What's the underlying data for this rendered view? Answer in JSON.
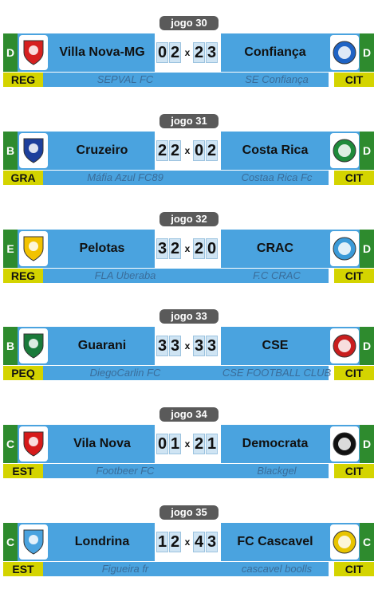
{
  "matches": [
    {
      "jogo": "jogo 30",
      "left_div": "D",
      "left_team": "Villa Nova-MG",
      "left_goals": [
        "0",
        "2"
      ],
      "right_goals": [
        "2",
        "3"
      ],
      "right_team": "Confiança",
      "right_div": "D",
      "left_cat": "REG",
      "left_coach": "SEPVAL FC",
      "right_coach": "SE Confiança",
      "right_cat": "CIT",
      "left_icon": "villa-nova-crest-icon",
      "right_icon": "confianca-crest-icon",
      "left_color": "#d62020",
      "right_color": "#1f63c4"
    },
    {
      "jogo": "jogo 31",
      "left_div": "B",
      "left_team": "Cruzeiro",
      "left_goals": [
        "2",
        "2"
      ],
      "right_goals": [
        "0",
        "2"
      ],
      "right_team": "Costa Rica",
      "right_div": "D",
      "left_cat": "GRA",
      "left_coach": "Máfia Azul FC89",
      "right_coach": "Costaa Rica Fc",
      "right_cat": "CIT",
      "left_icon": "cruzeiro-crest-icon",
      "right_icon": "costa-rica-crest-icon",
      "left_color": "#1d3f9c",
      "right_color": "#1f8a3a"
    },
    {
      "jogo": "jogo 32",
      "left_div": "E",
      "left_team": "Pelotas",
      "left_goals": [
        "3",
        "2"
      ],
      "right_goals": [
        "2",
        "0"
      ],
      "right_team": "CRAC",
      "right_div": "D",
      "left_cat": "REG",
      "left_coach": "FLA Uberaba",
      "right_coach": "F.C CRAC",
      "right_cat": "CIT",
      "left_icon": "pelotas-crest-icon",
      "right_icon": "crac-crest-icon",
      "left_color": "#f2c200",
      "right_color": "#3b9ad8"
    },
    {
      "jogo": "jogo 33",
      "left_div": "B",
      "left_team": "Guarani",
      "left_goals": [
        "3",
        "3"
      ],
      "right_goals": [
        "3",
        "3"
      ],
      "right_team": "CSE",
      "right_div": "D",
      "left_cat": "PEQ",
      "left_coach": "DiegoCarlin FC",
      "right_coach": "CSE FOOTBALL CLUB",
      "right_cat": "CIT",
      "left_icon": "guarani-crest-icon",
      "right_icon": "cse-crest-icon",
      "left_color": "#1a7a3a",
      "right_color": "#c81e1e"
    },
    {
      "jogo": "jogo 34",
      "left_div": "C",
      "left_team": "Vila Nova",
      "left_goals": [
        "0",
        "1"
      ],
      "right_goals": [
        "2",
        "1"
      ],
      "right_team": "Democrata",
      "right_div": "D",
      "left_cat": "EST",
      "left_coach": "Footbeer FC",
      "right_coach": "Blackgel",
      "right_cat": "CIT",
      "left_icon": "vila-nova-crest-icon",
      "right_icon": "democrata-crest-icon",
      "left_color": "#d61a1a",
      "right_color": "#111111"
    },
    {
      "jogo": "jogo 35",
      "left_div": "C",
      "left_team": "Londrina",
      "left_goals": [
        "1",
        "2"
      ],
      "right_goals": [
        "4",
        "3"
      ],
      "right_team": "FC Cascavel",
      "right_div": "C",
      "left_cat": "EST",
      "left_coach": "Figueira fr",
      "right_coach": "cascavel boolls",
      "right_cat": "CIT",
      "left_icon": "londrina-crest-icon",
      "right_icon": "cascavel-crest-icon",
      "left_color": "#4aa3df",
      "right_color": "#e8c400"
    }
  ],
  "score_separator": "x"
}
